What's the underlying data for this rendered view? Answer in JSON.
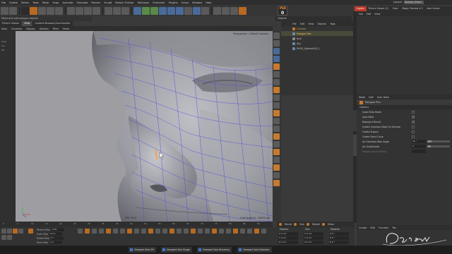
{
  "menubar": {
    "items": [
      "File",
      "Create",
      "Select",
      "Tools",
      "Mesh",
      "Snap",
      "Animate",
      "Simulate",
      "Render",
      "Sculpt",
      "Motion Tracker",
      "MoGraph",
      "Character",
      "Plugins",
      "Script",
      "Window",
      "Help"
    ],
    "layout_label": "Layout:",
    "layout_value": "Startup (User)"
  },
  "psr": {
    "label": "PSR",
    "value": "0"
  },
  "status_message": "Move and edit polygon objects",
  "viewport": {
    "tabs": [
      "Picture Viewer",
      "View",
      "Content Browser/Commander"
    ],
    "menu": [
      "View",
      "Cameras",
      "Display",
      "Options",
      "Filter",
      "Panel"
    ],
    "camera_label": "Perspective",
    "camera_label2": "Default Camera",
    "fps": "FPS: 50.0",
    "grid_spacing": "Grid Spacing : 10000 cm"
  },
  "left_objects": [
    "Total",
    "Sel",
    "EB"
  ],
  "right_tabs": [
    "Layers",
    "Picture Viewer (2)",
    "View",
    "Magic Preview 4.3",
    "Asst Center"
  ],
  "layers_menu": [
    "File",
    "Edit",
    "View"
  ],
  "object_manager": {
    "tabs": [
      "Objects",
      "Takes",
      "Content Browser"
    ],
    "menu": [
      "File",
      "Edit",
      "View",
      "Objects",
      "Tags",
      "Bookmarks"
    ],
    "rows": [
      {
        "name": "Camera",
        "selected": false
      },
      {
        "name": "Polygon Pen",
        "selected": true
      },
      {
        "name": "Null",
        "selected": false
      },
      {
        "name": "Sky",
        "selected": false
      },
      {
        "name": "PHSS_Sphere003_1",
        "selected": false
      }
    ]
  },
  "attribute_manager": {
    "menu": [
      "Mode",
      "Edit",
      "User Data"
    ],
    "title": "Polygon Pen",
    "section": "Options",
    "rows": [
      {
        "label": "Quad Strip Mode",
        "type": "check",
        "checked": false
      },
      {
        "label": "Auto Weld",
        "type": "check",
        "checked": true
      },
      {
        "label": "Reproject Result",
        "type": "check",
        "checked": true
      },
      {
        "label": "Create Cameron Edge On Extrude",
        "type": "check",
        "checked": false
      },
      {
        "label": "Create N-gons",
        "type": "check",
        "checked": false
      },
      {
        "label": "Create Semi Circle",
        "type": "check",
        "checked": false
      },
      {
        "label": "Arc Direction Max Angle",
        "type": "value",
        "value": "10 °",
        "fill": 0.2
      },
      {
        "label": "Arc Subdivision",
        "type": "value",
        "value": "4",
        "fill": 0.15
      },
      {
        "label": "Polygon Brush Radius",
        "type": "value",
        "value": "",
        "fill": 0.0,
        "dim": true
      }
    ]
  },
  "timeline": {
    "ticks": [
      "0",
      "5",
      "10",
      "15",
      "20",
      "25",
      "30",
      "35",
      "40",
      "45",
      "50",
      "55",
      "60",
      "65",
      "70",
      "75",
      "80",
      "85",
      "90"
    ]
  },
  "bottom": {
    "fields": [
      {
        "label": "Texture Step",
        "value": "0.00"
      },
      {
        "label": "Scale Step",
        "value": "10 %"
      },
      {
        "label": "Rotate Step",
        "value": "5 °"
      },
      {
        "label": "Move Step",
        "value": "1.0"
      }
    ]
  },
  "viewport_bar": [
    "Result",
    "Smo",
    "Weight",
    "Mirror"
  ],
  "coordinates": {
    "headers": [
      "Position",
      "Size",
      "Rotation"
    ],
    "rows": [
      {
        "pos": "X 0 cm",
        "size": "X 0 cm",
        "rot": "H 0 °"
      },
      {
        "pos": "Y 0 cm",
        "size": "Y 0 cm",
        "rot": "P 0 °"
      },
      {
        "pos": "Z 0 cm",
        "size": "Z 0 cm",
        "rot": "B 0 °"
      }
    ],
    "mode": "Object (Rel)",
    "size_mode": "Size",
    "apply": "Apply"
  },
  "rb_menu": [
    "Create",
    "Edit",
    "Function",
    "Tex"
  ],
  "taskbar": [
    "Viewport Solo Off",
    "Viewport Solo Single",
    "Viewport Solo Hierarchy",
    "Viewport Solo Selection"
  ],
  "signature": "Dacraw",
  "colors": {
    "accent_orange": "#c87a2a",
    "wire_blue": "#4a4ad8",
    "selection_red": "#c03a2a"
  }
}
